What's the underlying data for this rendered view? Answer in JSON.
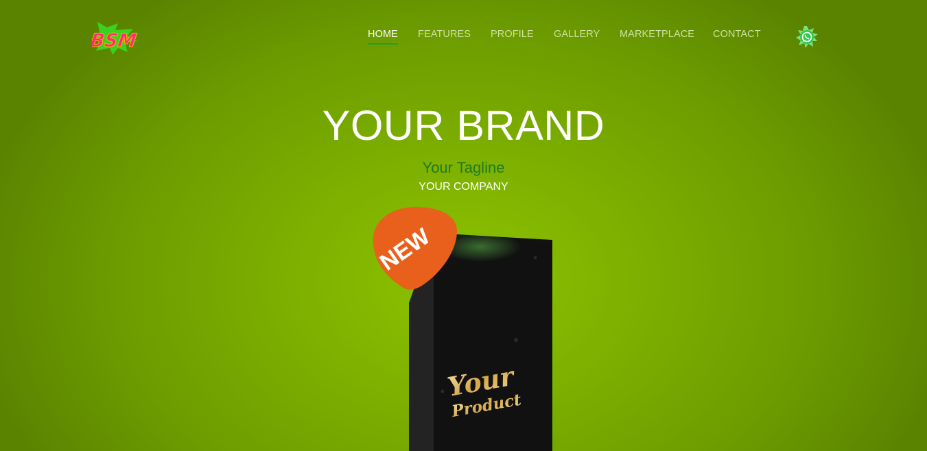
{
  "logo": {
    "icon": "bsm-logo-icon",
    "text": "BSM"
  },
  "nav": {
    "items": [
      {
        "label": "HOME",
        "active": true
      },
      {
        "label": "FEATURES",
        "active": false
      },
      {
        "label": "PROFILE",
        "active": false
      },
      {
        "label": "GALLERY",
        "active": false
      },
      {
        "label": "MARKETPLACE",
        "active": false
      },
      {
        "label": "CONTACT",
        "active": false
      }
    ],
    "whatsapp_icon": "whatsapp-icon"
  },
  "hero": {
    "title": "YOUR BRAND",
    "tagline": "Your Tagline",
    "company": "YOUR COMPANY"
  },
  "product": {
    "badge": "NEW",
    "line1": "Your",
    "line2": "Product"
  },
  "colors": {
    "background": "#7db000",
    "tagline": "#1f7a1f",
    "nav_active_underline": "#1fa21f",
    "badge": "#e8601c",
    "box": "#111111",
    "product_text": "#e0b860"
  }
}
